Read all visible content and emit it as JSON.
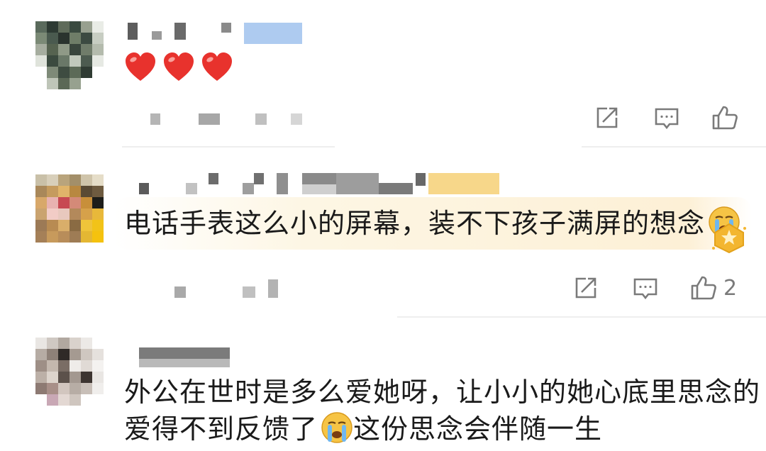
{
  "comments": [
    {
      "id": "c1",
      "username": "",
      "content_emoji": [
        "red-heart",
        "red-heart",
        "red-heart"
      ],
      "text": "",
      "like_count": ""
    },
    {
      "id": "c2",
      "username": "",
      "text": "电话手表这么小的屏幕，装不下孩子满屏的想念",
      "trailing_emoji": "loudly-crying-face",
      "badge_icon": "gold-star-badge-icon",
      "like_count": "2"
    },
    {
      "id": "c3",
      "username": "",
      "text_line1": "外公在世时是多么爱她呀，让小小的她心底里思念的",
      "text_line2_a": "爱得不到反馈了",
      "inline_emoji": "loudly-crying-face",
      "text_line2_b": "这份思念会伴随一生"
    }
  ],
  "action_icons": [
    "share-icon",
    "reply-icon",
    "like-icon"
  ],
  "colors": {
    "background": "#ffffff",
    "text": "#1a1a1a",
    "icon_gray": "#7a7a7a",
    "divider": "#eeeeee",
    "heart_red": "#e8322d",
    "highlight_bg": "#fdf6e4",
    "badge_gold": "#f3b630"
  }
}
